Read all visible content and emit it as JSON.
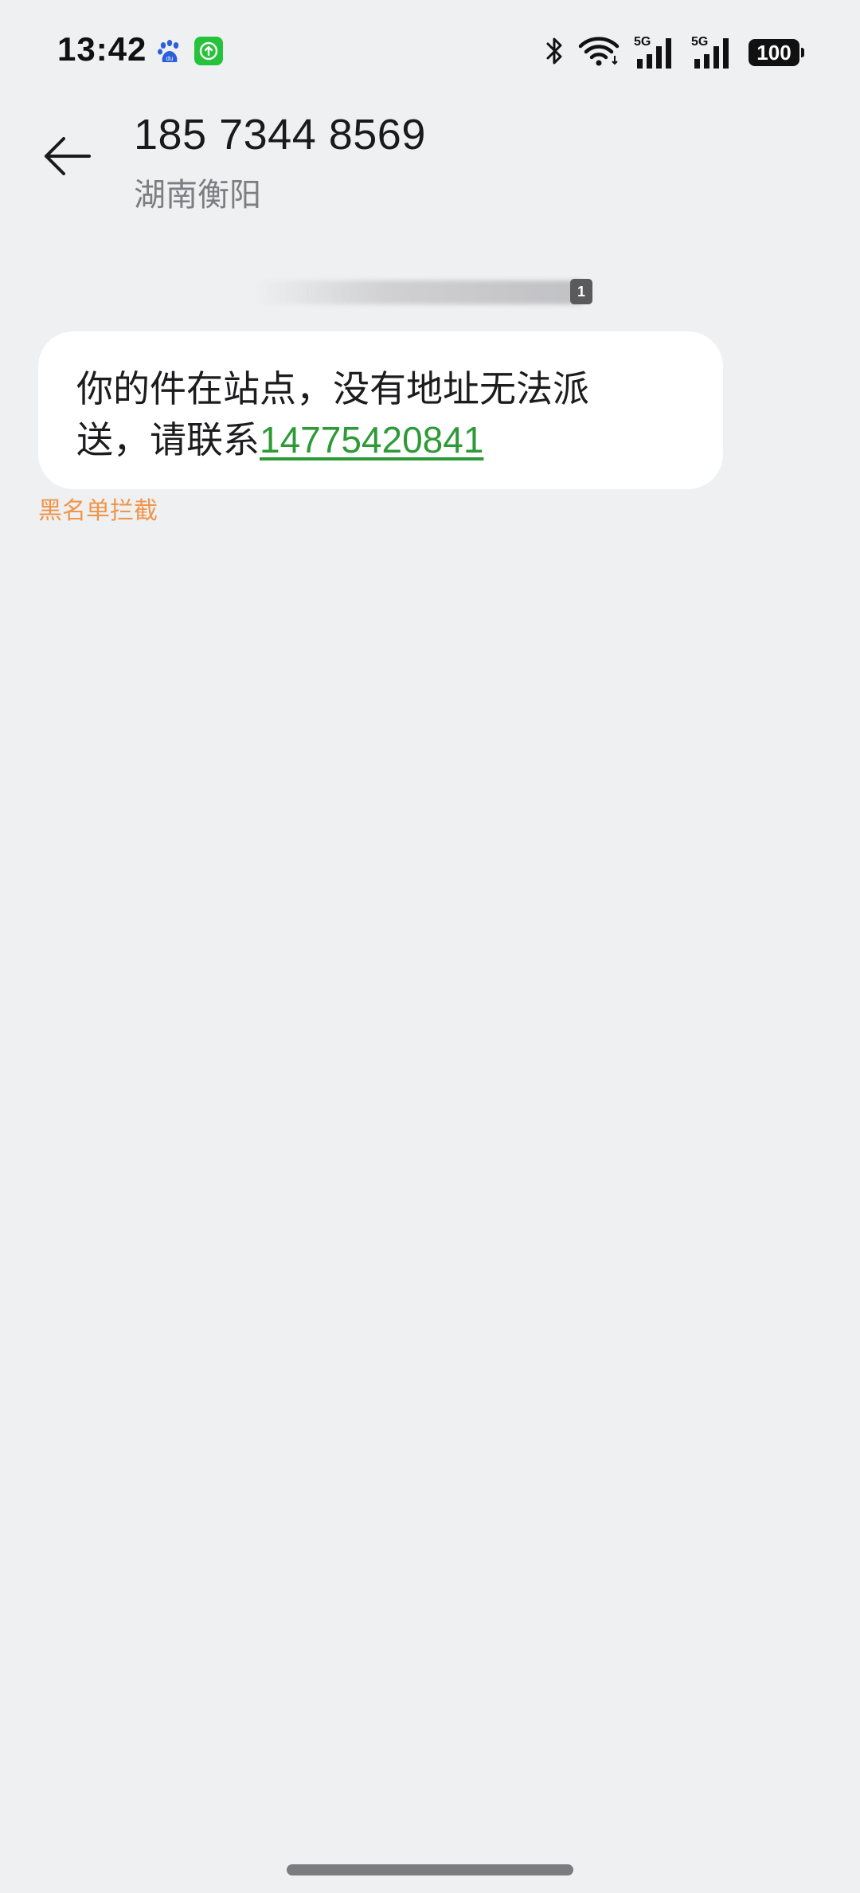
{
  "status_bar": {
    "time": "13:42",
    "notification_icons": [
      "baidu-icon",
      "upload-icon"
    ],
    "system_icons": [
      "bluetooth-icon",
      "wifi-icon",
      "signal-5g-icon",
      "signal-5g-icon"
    ],
    "network_label_1": "5G",
    "network_label_2": "5G",
    "battery_level": "100"
  },
  "header": {
    "contact_number": "185 7344 8569",
    "contact_location": "湖南衡阳"
  },
  "thread": {
    "sim_badge": "1",
    "message": {
      "text": "你的件在站点，没有地址无法派送，请联系",
      "link_text": "14775420841"
    },
    "status_label": "黑名单拦截"
  },
  "colors": {
    "background": "#eff0f2",
    "bubble": "#ffffff",
    "link": "#2e9a37",
    "warning": "#f0954a"
  }
}
